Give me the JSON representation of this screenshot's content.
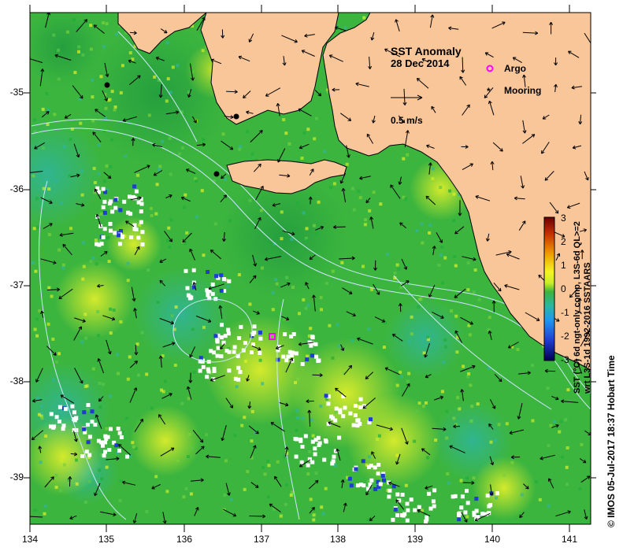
{
  "map": {
    "title": "SST Anomaly",
    "date": "28 Dec 2014",
    "lon_labels": [
      "134",
      "135",
      "136",
      "137",
      "138",
      "139",
      "140",
      "141"
    ],
    "lat_labels": [
      "-35",
      "-36",
      "-37",
      "-38",
      "-39"
    ],
    "colors": {
      "land": "#f9c699",
      "ocean_base": "#3cb53e",
      "no_data": "#ffffff",
      "coastline": "#000000",
      "bathymetry": "#cfe6ff",
      "current_vector": "#000000"
    }
  },
  "legend": {
    "argo_label": "Argo",
    "argo_color": "#ff00ff",
    "mooring_label": "Mooring",
    "mooring_color": "#000000",
    "vector_scale_label": "0.5 m/s"
  },
  "colorbar": {
    "ticks": [
      "3",
      "2",
      "1",
      "0",
      "-1",
      "-2",
      "-3"
    ],
    "caption_1": "SST (°C) 6d ngt-only comp, L3S-6d QL>=2",
    "caption_2": "wrt L3S-1d 1992-2016 SSTAARS",
    "stops": [
      "#6a0000",
      "#c83200",
      "#f0a000",
      "#f5f51e",
      "#c8ee28",
      "#3cb43c",
      "#2bb6a3",
      "#1e96f0",
      "#1e3cd2",
      "#000050"
    ]
  },
  "credit": {
    "text": "© IMOS 05-Jul-2017 18:37 Hobart Time"
  }
}
